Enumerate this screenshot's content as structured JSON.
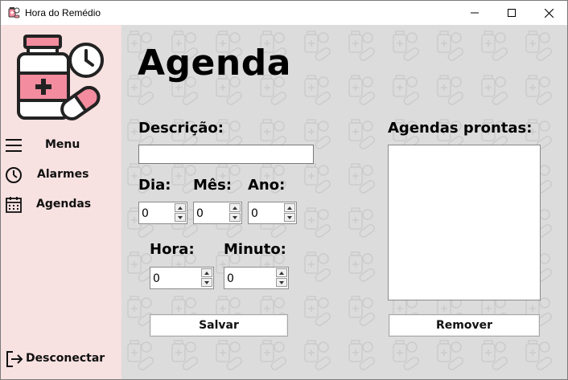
{
  "window": {
    "title": "Hora do Remédio",
    "controls": {
      "minimize": "minimize-icon",
      "maximize": "maximize-icon",
      "close": "close-icon"
    }
  },
  "sidebar": {
    "logo": "medicine-clock-logo",
    "items": [
      {
        "label": "Menu",
        "icon": "hamburger-icon"
      },
      {
        "label": "Alarmes",
        "icon": "clock-icon"
      },
      {
        "label": "Agendas",
        "icon": "calendar-icon"
      }
    ],
    "logout": {
      "label": "Desconectar",
      "icon": "logout-icon"
    }
  },
  "main": {
    "title": "Agenda",
    "description": {
      "label": "Descrição:",
      "value": ""
    },
    "day": {
      "label": "Dia:",
      "value": "0"
    },
    "month": {
      "label": "Mês:",
      "value": "0"
    },
    "year": {
      "label": "Ano:",
      "value": "0"
    },
    "hour": {
      "label": "Hora:",
      "value": "0"
    },
    "minute": {
      "label": "Minuto:",
      "value": "0"
    },
    "save_button": "Salvar",
    "list": {
      "label": "Agendas prontas:",
      "items": []
    },
    "remove_button": "Remover"
  },
  "colors": {
    "sidebar_bg": "#f8e1e1",
    "main_bg": "#dcdcdc",
    "logo_pink": "#f28c9e"
  }
}
